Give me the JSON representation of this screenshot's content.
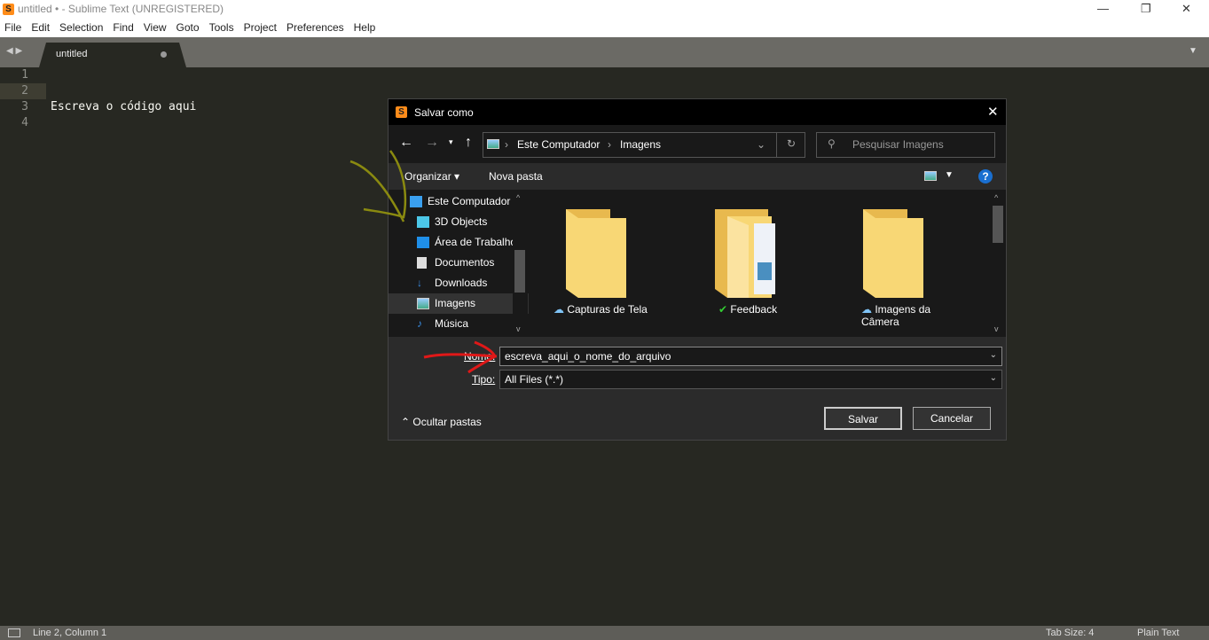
{
  "window": {
    "title": "untitled • - Sublime Text (UNREGISTERED)"
  },
  "menu": [
    "File",
    "Edit",
    "Selection",
    "Find",
    "View",
    "Goto",
    "Tools",
    "Project",
    "Preferences",
    "Help"
  ],
  "tab": {
    "label": "untitled"
  },
  "editor": {
    "lines": [
      "1",
      "2",
      "3",
      "4"
    ],
    "code": "Escreva o código aqui"
  },
  "status": {
    "position": "Line 2, Column 1",
    "tab_size": "Tab Size: 4",
    "syntax": "Plain Text"
  },
  "dialog": {
    "title": "Salvar como",
    "breadcrumb": [
      "Este Computador",
      "Imagens"
    ],
    "search_placeholder": "Pesquisar Imagens",
    "organize": "Organizar",
    "new_folder": "Nova pasta",
    "nav": [
      "Este Computador",
      "3D Objects",
      "Área de Trabalho",
      "Documentos",
      "Downloads",
      "Imagens",
      "Música"
    ],
    "folders": [
      {
        "name": "Capturas de Tela",
        "status": "cloud"
      },
      {
        "name": "Feedback",
        "status": "synced"
      },
      {
        "name": "Imagens da Câmera",
        "status": "cloud"
      }
    ],
    "name_label": "Nome:",
    "name_value": "escreva_aqui_o_nome_do_arquivo",
    "type_label": "Tipo:",
    "type_value": "All Files (*.*)",
    "hide_folders": "Ocultar pastas",
    "save": "Salvar",
    "cancel": "Cancelar"
  },
  "colors": {
    "accent": "#ff8c1a",
    "editor_bg": "#272822",
    "folder": "#f8d775"
  }
}
